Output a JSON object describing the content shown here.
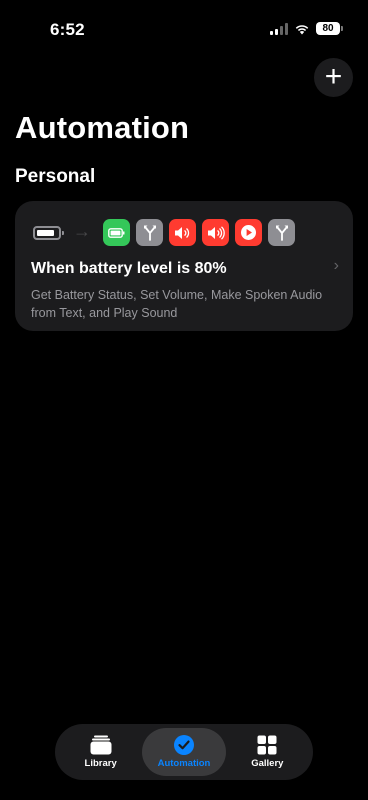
{
  "status_bar": {
    "time": "6:52",
    "battery": "80"
  },
  "header": {
    "title": "Automation",
    "add_icon": "plus-icon"
  },
  "section": {
    "title": "Personal"
  },
  "automation": {
    "title": "When battery level is 80%",
    "subtitle": "Get Battery Status, Set Volume, Make Spoken Audio from Text, and Play Sound",
    "trigger_icon": "battery-icon",
    "action_icons": [
      "battery-status-icon",
      "branch-icon",
      "volume-icon",
      "volume-icon",
      "play-icon",
      "branch-icon"
    ]
  },
  "tab_bar": {
    "tabs": [
      {
        "label": "Library",
        "icon": "library-icon",
        "active": false
      },
      {
        "label": "Automation",
        "icon": "automation-clock-icon",
        "active": true
      },
      {
        "label": "Gallery",
        "icon": "gallery-grid-icon",
        "active": false
      }
    ]
  },
  "colors": {
    "green": "#34c759",
    "red": "#ff3b30",
    "gray": "#8e8e93",
    "accent": "#0a84ff"
  }
}
